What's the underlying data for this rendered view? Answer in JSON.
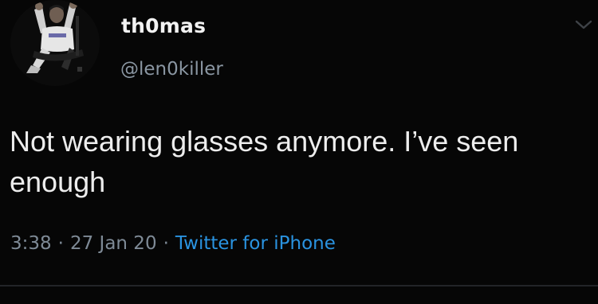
{
  "tweet": {
    "display_name": "th0mas",
    "handle": "@len0killer",
    "text": "Not wearing glasses anymore. I’ve seen enough",
    "time": "3:38",
    "date": "27 Jan 20",
    "source": "Twitter for iPhone",
    "separator": "·"
  },
  "icons": {
    "avatar": "profile-photo",
    "menu": "chevron-down-icon"
  },
  "colors": {
    "background": "#060606",
    "name": "#f2f2f2",
    "handle": "#8a96a2",
    "text": "#ededed",
    "meta": "#7e8a96",
    "source_link": "#2a93e0",
    "divider": "#222428"
  }
}
